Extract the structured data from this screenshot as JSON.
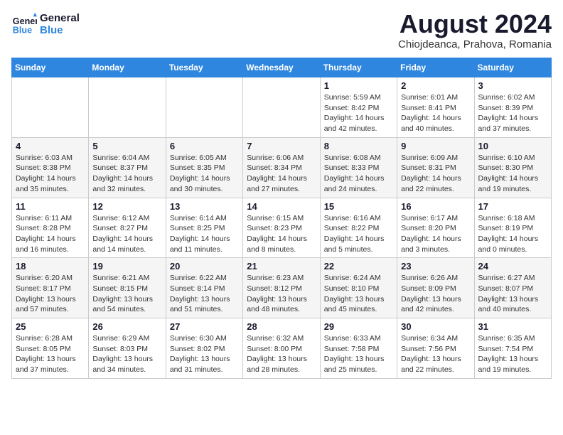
{
  "header": {
    "logo_line1": "General",
    "logo_line2": "Blue",
    "month": "August 2024",
    "location": "Chiojdeanca, Prahova, Romania"
  },
  "weekdays": [
    "Sunday",
    "Monday",
    "Tuesday",
    "Wednesday",
    "Thursday",
    "Friday",
    "Saturday"
  ],
  "weeks": [
    [
      {
        "day": "",
        "info": ""
      },
      {
        "day": "",
        "info": ""
      },
      {
        "day": "",
        "info": ""
      },
      {
        "day": "",
        "info": ""
      },
      {
        "day": "1",
        "info": "Sunrise: 5:59 AM\nSunset: 8:42 PM\nDaylight: 14 hours\nand 42 minutes."
      },
      {
        "day": "2",
        "info": "Sunrise: 6:01 AM\nSunset: 8:41 PM\nDaylight: 14 hours\nand 40 minutes."
      },
      {
        "day": "3",
        "info": "Sunrise: 6:02 AM\nSunset: 8:39 PM\nDaylight: 14 hours\nand 37 minutes."
      }
    ],
    [
      {
        "day": "4",
        "info": "Sunrise: 6:03 AM\nSunset: 8:38 PM\nDaylight: 14 hours\nand 35 minutes."
      },
      {
        "day": "5",
        "info": "Sunrise: 6:04 AM\nSunset: 8:37 PM\nDaylight: 14 hours\nand 32 minutes."
      },
      {
        "day": "6",
        "info": "Sunrise: 6:05 AM\nSunset: 8:35 PM\nDaylight: 14 hours\nand 30 minutes."
      },
      {
        "day": "7",
        "info": "Sunrise: 6:06 AM\nSunset: 8:34 PM\nDaylight: 14 hours\nand 27 minutes."
      },
      {
        "day": "8",
        "info": "Sunrise: 6:08 AM\nSunset: 8:33 PM\nDaylight: 14 hours\nand 24 minutes."
      },
      {
        "day": "9",
        "info": "Sunrise: 6:09 AM\nSunset: 8:31 PM\nDaylight: 14 hours\nand 22 minutes."
      },
      {
        "day": "10",
        "info": "Sunrise: 6:10 AM\nSunset: 8:30 PM\nDaylight: 14 hours\nand 19 minutes."
      }
    ],
    [
      {
        "day": "11",
        "info": "Sunrise: 6:11 AM\nSunset: 8:28 PM\nDaylight: 14 hours\nand 16 minutes."
      },
      {
        "day": "12",
        "info": "Sunrise: 6:12 AM\nSunset: 8:27 PM\nDaylight: 14 hours\nand 14 minutes."
      },
      {
        "day": "13",
        "info": "Sunrise: 6:14 AM\nSunset: 8:25 PM\nDaylight: 14 hours\nand 11 minutes."
      },
      {
        "day": "14",
        "info": "Sunrise: 6:15 AM\nSunset: 8:23 PM\nDaylight: 14 hours\nand 8 minutes."
      },
      {
        "day": "15",
        "info": "Sunrise: 6:16 AM\nSunset: 8:22 PM\nDaylight: 14 hours\nand 5 minutes."
      },
      {
        "day": "16",
        "info": "Sunrise: 6:17 AM\nSunset: 8:20 PM\nDaylight: 14 hours\nand 3 minutes."
      },
      {
        "day": "17",
        "info": "Sunrise: 6:18 AM\nSunset: 8:19 PM\nDaylight: 14 hours\nand 0 minutes."
      }
    ],
    [
      {
        "day": "18",
        "info": "Sunrise: 6:20 AM\nSunset: 8:17 PM\nDaylight: 13 hours\nand 57 minutes."
      },
      {
        "day": "19",
        "info": "Sunrise: 6:21 AM\nSunset: 8:15 PM\nDaylight: 13 hours\nand 54 minutes."
      },
      {
        "day": "20",
        "info": "Sunrise: 6:22 AM\nSunset: 8:14 PM\nDaylight: 13 hours\nand 51 minutes."
      },
      {
        "day": "21",
        "info": "Sunrise: 6:23 AM\nSunset: 8:12 PM\nDaylight: 13 hours\nand 48 minutes."
      },
      {
        "day": "22",
        "info": "Sunrise: 6:24 AM\nSunset: 8:10 PM\nDaylight: 13 hours\nand 45 minutes."
      },
      {
        "day": "23",
        "info": "Sunrise: 6:26 AM\nSunset: 8:09 PM\nDaylight: 13 hours\nand 42 minutes."
      },
      {
        "day": "24",
        "info": "Sunrise: 6:27 AM\nSunset: 8:07 PM\nDaylight: 13 hours\nand 40 minutes."
      }
    ],
    [
      {
        "day": "25",
        "info": "Sunrise: 6:28 AM\nSunset: 8:05 PM\nDaylight: 13 hours\nand 37 minutes."
      },
      {
        "day": "26",
        "info": "Sunrise: 6:29 AM\nSunset: 8:03 PM\nDaylight: 13 hours\nand 34 minutes."
      },
      {
        "day": "27",
        "info": "Sunrise: 6:30 AM\nSunset: 8:02 PM\nDaylight: 13 hours\nand 31 minutes."
      },
      {
        "day": "28",
        "info": "Sunrise: 6:32 AM\nSunset: 8:00 PM\nDaylight: 13 hours\nand 28 minutes."
      },
      {
        "day": "29",
        "info": "Sunrise: 6:33 AM\nSunset: 7:58 PM\nDaylight: 13 hours\nand 25 minutes."
      },
      {
        "day": "30",
        "info": "Sunrise: 6:34 AM\nSunset: 7:56 PM\nDaylight: 13 hours\nand 22 minutes."
      },
      {
        "day": "31",
        "info": "Sunrise: 6:35 AM\nSunset: 7:54 PM\nDaylight: 13 hours\nand 19 minutes."
      }
    ]
  ]
}
